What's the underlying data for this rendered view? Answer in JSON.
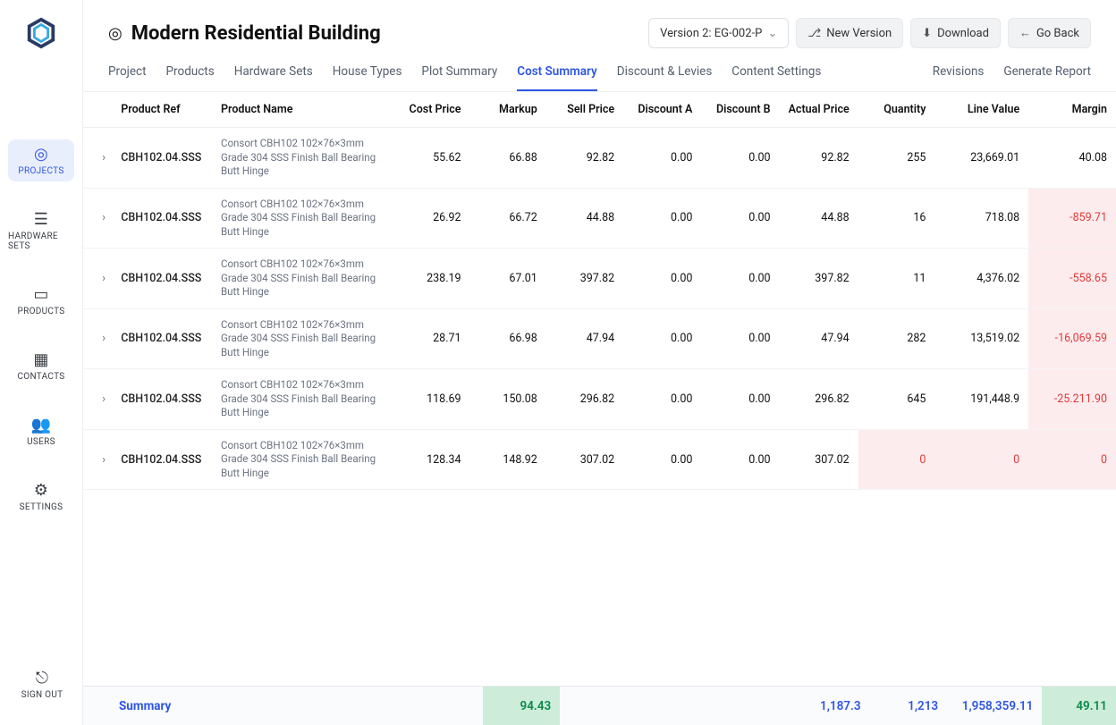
{
  "sidebar": {
    "items": [
      {
        "label": "PROJECTS"
      },
      {
        "label": "HARDWARE SETS"
      },
      {
        "label": "PRODUCTS"
      },
      {
        "label": "CONTACTS"
      },
      {
        "label": "USERS"
      },
      {
        "label": "SETTINGS"
      }
    ],
    "signout": "SIGN OUT"
  },
  "header": {
    "title": "Modern Residential Building",
    "version_select": "Version 2: EG-002-P",
    "new_version": "New Version",
    "download": "Download",
    "go_back": "Go Back"
  },
  "tabs": {
    "items": [
      "Project",
      "Products",
      "Hardware Sets",
      "House Types",
      "Plot Summary",
      "Cost Summary",
      "Discount & Levies",
      "Content Settings"
    ],
    "active_index": 5,
    "revisions": "Revisions",
    "generate_report": "Generate Report"
  },
  "table": {
    "headers": [
      "",
      "Product Ref",
      "Product Name",
      "Cost Price",
      "Markup",
      "Sell Price",
      "Discount A",
      "Discount B",
      "Actual Price",
      "Quantity",
      "Line Value",
      "Margin"
    ],
    "rows": [
      {
        "ref": "CBH102.04.SSS",
        "name": "Consort CBH102 102×76×3mm Grade 304 SSS Finish Ball Bearing Butt Hinge",
        "cost": "55.62",
        "markup": "66.88",
        "sell": "92.82",
        "da": "0.00",
        "db": "0.00",
        "actual": "92.82",
        "qty": "255",
        "line": "23,669.01",
        "margin": "40.08",
        "margin_neg": false
      },
      {
        "ref": "CBH102.04.SSS",
        "name": "Consort CBH102 102×76×3mm Grade 304 SSS Finish Ball Bearing Butt Hinge",
        "cost": "26.92",
        "markup": "66.72",
        "sell": "44.88",
        "da": "0.00",
        "db": "0.00",
        "actual": "44.88",
        "qty": "16",
        "line": "718.08",
        "margin": "-859.71",
        "margin_neg": true
      },
      {
        "ref": "CBH102.04.SSS",
        "name": "Consort CBH102 102×76×3mm Grade 304 SSS Finish Ball Bearing Butt Hinge",
        "cost": "238.19",
        "markup": "67.01",
        "sell": "397.82",
        "da": "0.00",
        "db": "0.00",
        "actual": "397.82",
        "qty": "11",
        "line": "4,376.02",
        "margin": "-558.65",
        "margin_neg": true
      },
      {
        "ref": "CBH102.04.SSS",
        "name": "Consort CBH102 102×76×3mm Grade 304 SSS Finish Ball Bearing Butt Hinge",
        "cost": "28.71",
        "markup": "66.98",
        "sell": "47.94",
        "da": "0.00",
        "db": "0.00",
        "actual": "47.94",
        "qty": "282",
        "line": "13,519.02",
        "margin": "-16,069.59",
        "margin_neg": true
      },
      {
        "ref": "CBH102.04.SSS",
        "name": "Consort CBH102 102×76×3mm Grade 304 SSS Finish Ball Bearing Butt Hinge",
        "cost": "118.69",
        "markup": "150.08",
        "sell": "296.82",
        "da": "0.00",
        "db": "0.00",
        "actual": "296.82",
        "qty": "645",
        "line": "191,448.9",
        "margin": "-25.211.90",
        "margin_neg": true
      },
      {
        "ref": "CBH102.04.SSS",
        "name": "Consort CBH102 102×76×3mm Grade 304 SSS Finish Ball Bearing Butt Hinge",
        "cost": "128.34",
        "markup": "148.92",
        "sell": "307.02",
        "da": "0.00",
        "db": "0.00",
        "actual": "307.02",
        "qty": "0",
        "line": "0",
        "margin": "0",
        "zero_row": true
      }
    ]
  },
  "summary": {
    "label": "Summary",
    "markup": "94.43",
    "actual": "1,187.3",
    "qty": "1,213",
    "line": "1,958,359.11",
    "margin": "49.11"
  }
}
